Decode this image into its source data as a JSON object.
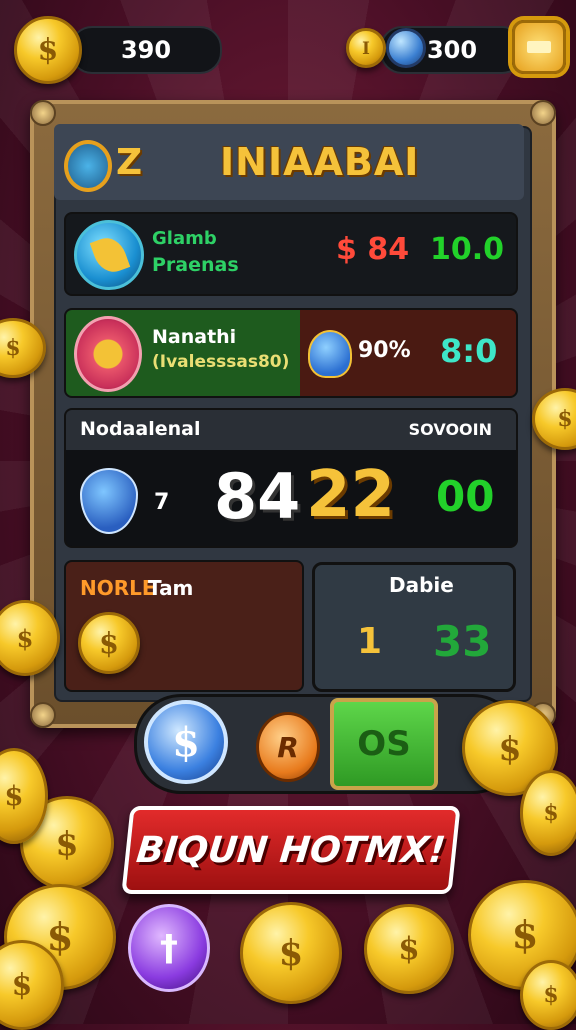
{
  "topbar": {
    "coins_value": "390",
    "gems_value": "300"
  },
  "panel": {
    "title": "INIAABAI",
    "header_level": "Z"
  },
  "rows": [
    {
      "name_line1": "Glamb",
      "name_line2": "Praenas",
      "left_value": "$ 84",
      "right_value": "10.0"
    },
    {
      "name_line1": "Nanathi",
      "name_line2": "(Ivalesssas80)",
      "percent": "90%",
      "right_value": "8:0"
    }
  ],
  "score": {
    "left_label": "Nodaalenal",
    "right_label": "SOVOOIN",
    "count": "7",
    "big_white": "84",
    "big_yellow": "22",
    "big_green": "00"
  },
  "bottom_left": {
    "label_orange": "NORLE",
    "label_white": "Tam"
  },
  "bottom_right": {
    "label": "Dabie",
    "left_value": "1",
    "right_value": "33"
  },
  "buttons": {
    "green_label": "OS",
    "cta_label": "BIQUN HOTMX!",
    "orange_coin": "R"
  },
  "colors": {
    "gold": "#f5c23a",
    "green": "#22d12a",
    "red": "#e22b2b",
    "panel": "#303741"
  }
}
